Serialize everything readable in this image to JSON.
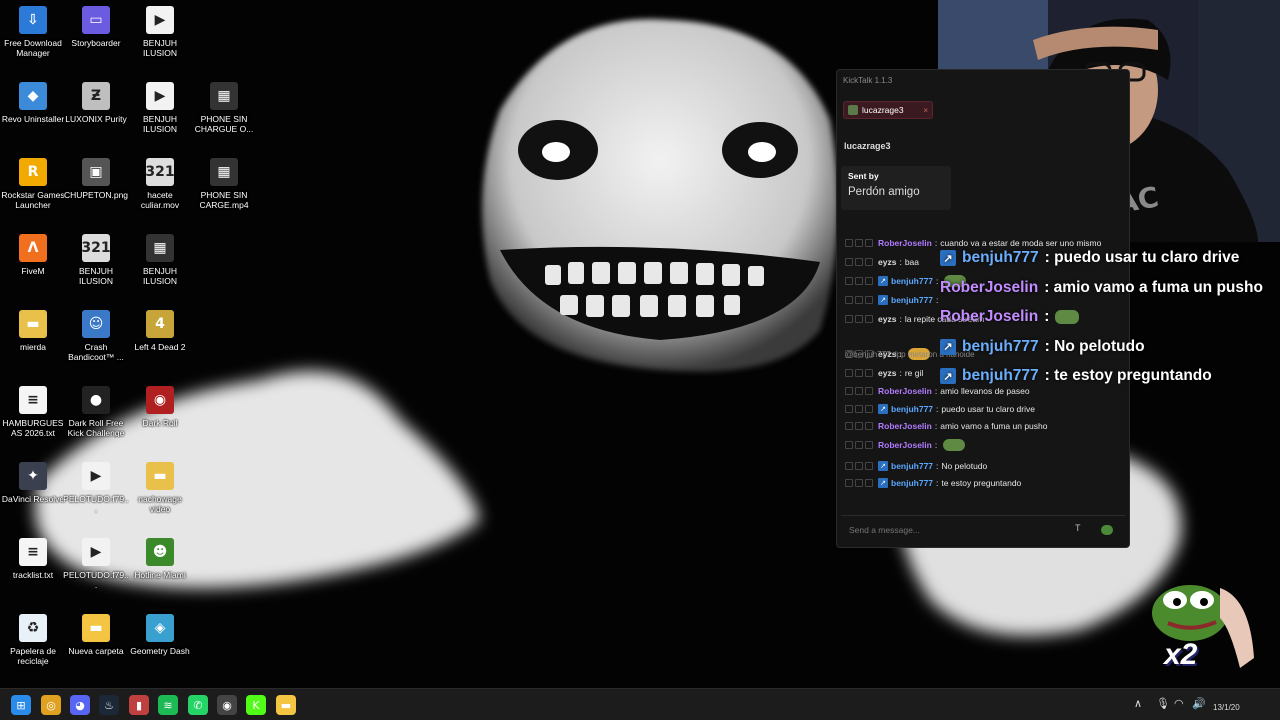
{
  "desktop": {
    "icons": [
      {
        "label": "Free Download Manager",
        "icon": "fdm-icon",
        "color": "#2b7ad8",
        "glyph": "⇩"
      },
      {
        "label": "Storyboarder",
        "icon": "storyboarder-icon",
        "color": "#6a5be0",
        "glyph": "▭"
      },
      {
        "label": "BENJUH ILUSION OPTICA FINAL....",
        "icon": "video-file-icon",
        "color": "#f2f2f2",
        "glyph": "▶"
      },
      {
        "label": "Revo Uninstaller",
        "icon": "revo-uninstaller-icon",
        "color": "#3c8bd8",
        "glyph": "◆"
      },
      {
        "label": "LUXONIX Purity",
        "icon": "purity-icon",
        "color": "#bfbfbf",
        "glyph": "Ƶ"
      },
      {
        "label": "BENJUH ILUSION OPTICA FINAL....",
        "icon": "video-file-icon",
        "color": "#f2f2f2",
        "glyph": "▶"
      },
      {
        "label": "PHONE SIN CHARGUE O...",
        "icon": "video-thumb-icon",
        "color": "#333333",
        "glyph": "▦"
      },
      {
        "label": "Rockstar Games Launcher",
        "icon": "rockstar-icon",
        "color": "#f2a900",
        "glyph": "R"
      },
      {
        "label": "CHUPETON.png",
        "icon": "image-file-icon",
        "color": "#555555",
        "glyph": "▣"
      },
      {
        "label": "hacete culiar.mov",
        "icon": "movie-file-icon",
        "color": "#dddddd",
        "glyph": "321"
      },
      {
        "label": "PHONE SIN CARGE.mp4",
        "icon": "video-thumb-icon",
        "color": "#333333",
        "glyph": "▦"
      },
      {
        "label": "FiveM",
        "icon": "fivem-icon",
        "color": "#f07020",
        "glyph": "Λ"
      },
      {
        "label": "BENJUH ILUSION OPTICA.mov",
        "icon": "movie-file-icon",
        "color": "#dddddd",
        "glyph": "321"
      },
      {
        "label": "BENJUH ILUSION OPTICA VIDEO ...",
        "icon": "video-thumb-icon",
        "color": "#333333",
        "glyph": "▦"
      },
      {
        "label": "mierda",
        "icon": "folder-icon",
        "color": "#e8c04a",
        "glyph": "▬"
      },
      {
        "label": "Crash Bandicoot™ ...",
        "icon": "crash-bandicoot-icon",
        "color": "#3a78c8",
        "glyph": "☺"
      },
      {
        "label": "Left 4 Dead 2",
        "icon": "left4dead-icon",
        "color": "#c7a538",
        "glyph": "4"
      },
      {
        "label": "HAMBURGUESAS 2026.txt",
        "icon": "text-file-icon",
        "color": "#f5f5f5",
        "glyph": "≡"
      },
      {
        "label": "Dark Roll Free Kick Challenge",
        "icon": "soccer-ball-icon",
        "color": "#222222",
        "glyph": "●"
      },
      {
        "label": "Dark Roll",
        "icon": "dark-roll-icon",
        "color": "#b02020",
        "glyph": "◉"
      },
      {
        "label": "DaVinci Resolve",
        "icon": "davinci-icon",
        "color": "#3a4050",
        "glyph": "✦"
      },
      {
        "label": "PELOTUDO.f79...",
        "icon": "video-file-icon",
        "color": "#f2f2f2",
        "glyph": "▶"
      },
      {
        "label": "nachowage video",
        "icon": "folder-icon",
        "color": "#e8c04a",
        "glyph": "▬"
      },
      {
        "label": "tracklist.txt",
        "icon": "text-file-icon",
        "color": "#f5f5f5",
        "glyph": "≡"
      },
      {
        "label": "PELOTUDO.f79...",
        "icon": "video-file-icon",
        "color": "#f2f2f2",
        "glyph": "▶"
      },
      {
        "label": "Hotline Miami",
        "icon": "hotline-miami-icon",
        "color": "#3a8a2a",
        "glyph": "☻"
      },
      {
        "label": "Papelera de reciclaje",
        "icon": "recycle-bin-icon",
        "color": "#e8f0f8",
        "glyph": "♻"
      },
      {
        "label": "Nueva carpeta",
        "icon": "folder-icon",
        "color": "#f4c542",
        "glyph": "▬"
      },
      {
        "label": "Geometry Dash",
        "icon": "geometry-dash-icon",
        "color": "#3aa0d0",
        "glyph": "◈"
      }
    ]
  },
  "kicktalk": {
    "title": "KickTalk 1.1.3",
    "tab_label": "lucazrage3",
    "tab_close": "×",
    "channel_name": "lucazrage3",
    "pinned": {
      "sent_by": "Sent by",
      "message": "Perdón amigo"
    },
    "messages": [
      {
        "user": "RoberJoselin",
        "color": "purple",
        "badge": false,
        "text": "cuando va a estar de moda ser uno mismo",
        "emote": ""
      },
      {
        "user": "eyzs",
        "color": "white",
        "badge": false,
        "text": "baa",
        "emote": ""
      },
      {
        "user": "benjuh777",
        "color": "blue",
        "badge": true,
        "text": "",
        "emote": "green"
      },
      {
        "user": "benjuh777",
        "color": "blue",
        "badge": true,
        "text": "",
        "emote": ""
      },
      {
        "user": "eyzs",
        "color": "white",
        "badge": false,
        "text": "la repite cada stream",
        "emote": ""
      },
      {
        "user": "eyzs",
        "color": "white",
        "badge": false,
        "text": "",
        "emote": "yellow"
      },
      {
        "user": "eyzs",
        "color": "white",
        "badge": false,
        "text": "re gil",
        "emote": ""
      },
      {
        "user": "RoberJoselin",
        "color": "purple",
        "badge": false,
        "text": "amio llevanos de paseo",
        "emote": ""
      },
      {
        "user": "benjuh777",
        "color": "blue",
        "badge": true,
        "text": "puedo usar tu claro drive",
        "emote": ""
      },
      {
        "user": "RoberJoselin",
        "color": "purple",
        "badge": false,
        "text": "amio vamo a fuma un pusho",
        "emote": ""
      },
      {
        "user": "RoberJoselin",
        "color": "purple",
        "badge": false,
        "text": "",
        "emote": "green"
      },
      {
        "user": "benjuh777",
        "color": "blue",
        "badge": true,
        "text": "No pelotudo",
        "emote": ""
      },
      {
        "user": "benjuh777",
        "color": "blue",
        "badge": true,
        "text": "te estoy preguntando",
        "emote": ""
      }
    ],
    "reply_text": "@benjuh777: lpp metaron a nanoide",
    "input_placeholder": "Send a message...",
    "translate_icon_glyph": "T"
  },
  "overlay_chat": [
    {
      "user": "benjuh777",
      "color": "blue",
      "badge": true,
      "text": ": puedo usar tu claro drive",
      "emote": ""
    },
    {
      "user": "RoberJoselin",
      "color": "purple",
      "badge": false,
      "text": ": amio vamo a fuma un pusho",
      "emote": ""
    },
    {
      "user": "RoberJoselin",
      "color": "purple",
      "badge": false,
      "text": " :",
      "emote": "green"
    },
    {
      "user": "benjuh777",
      "color": "blue",
      "badge": true,
      "text": ": No pelotudo",
      "emote": ""
    },
    {
      "user": "benjuh777",
      "color": "blue",
      "badge": true,
      "text": ": te estoy preguntando",
      "emote": ""
    }
  ],
  "combo": {
    "label": "x2"
  },
  "taskbar": {
    "apps": [
      {
        "name": "windows-start-icon",
        "color": "#2a8be8",
        "glyph": "⊞"
      },
      {
        "name": "chrome-icon",
        "color": "#e0a020",
        "glyph": "◎"
      },
      {
        "name": "discord-icon",
        "color": "#5865f2",
        "glyph": "◕"
      },
      {
        "name": "steam-icon",
        "color": "#1b2838",
        "glyph": "♨"
      },
      {
        "name": "app-icon",
        "color": "#c04040",
        "glyph": "▮"
      },
      {
        "name": "spotify-icon",
        "color": "#1db954",
        "glyph": "≋"
      },
      {
        "name": "whatsapp-icon",
        "color": "#25d366",
        "glyph": "✆"
      },
      {
        "name": "obs-icon",
        "color": "#444444",
        "glyph": "◉"
      },
      {
        "name": "kick-icon",
        "color": "#53fc18",
        "glyph": "K"
      },
      {
        "name": "file-explorer-icon",
        "color": "#f4c542",
        "glyph": "▬"
      }
    ],
    "tray": {
      "chevron": "∧",
      "mic": "🎙",
      "wifi": "◠",
      "volume": "🔊",
      "clock": "13/1/20"
    }
  },
  "colors": {
    "kick_green": "#53fc18",
    "purple_user": "#b27bff",
    "blue_user": "#5aa8ff"
  }
}
